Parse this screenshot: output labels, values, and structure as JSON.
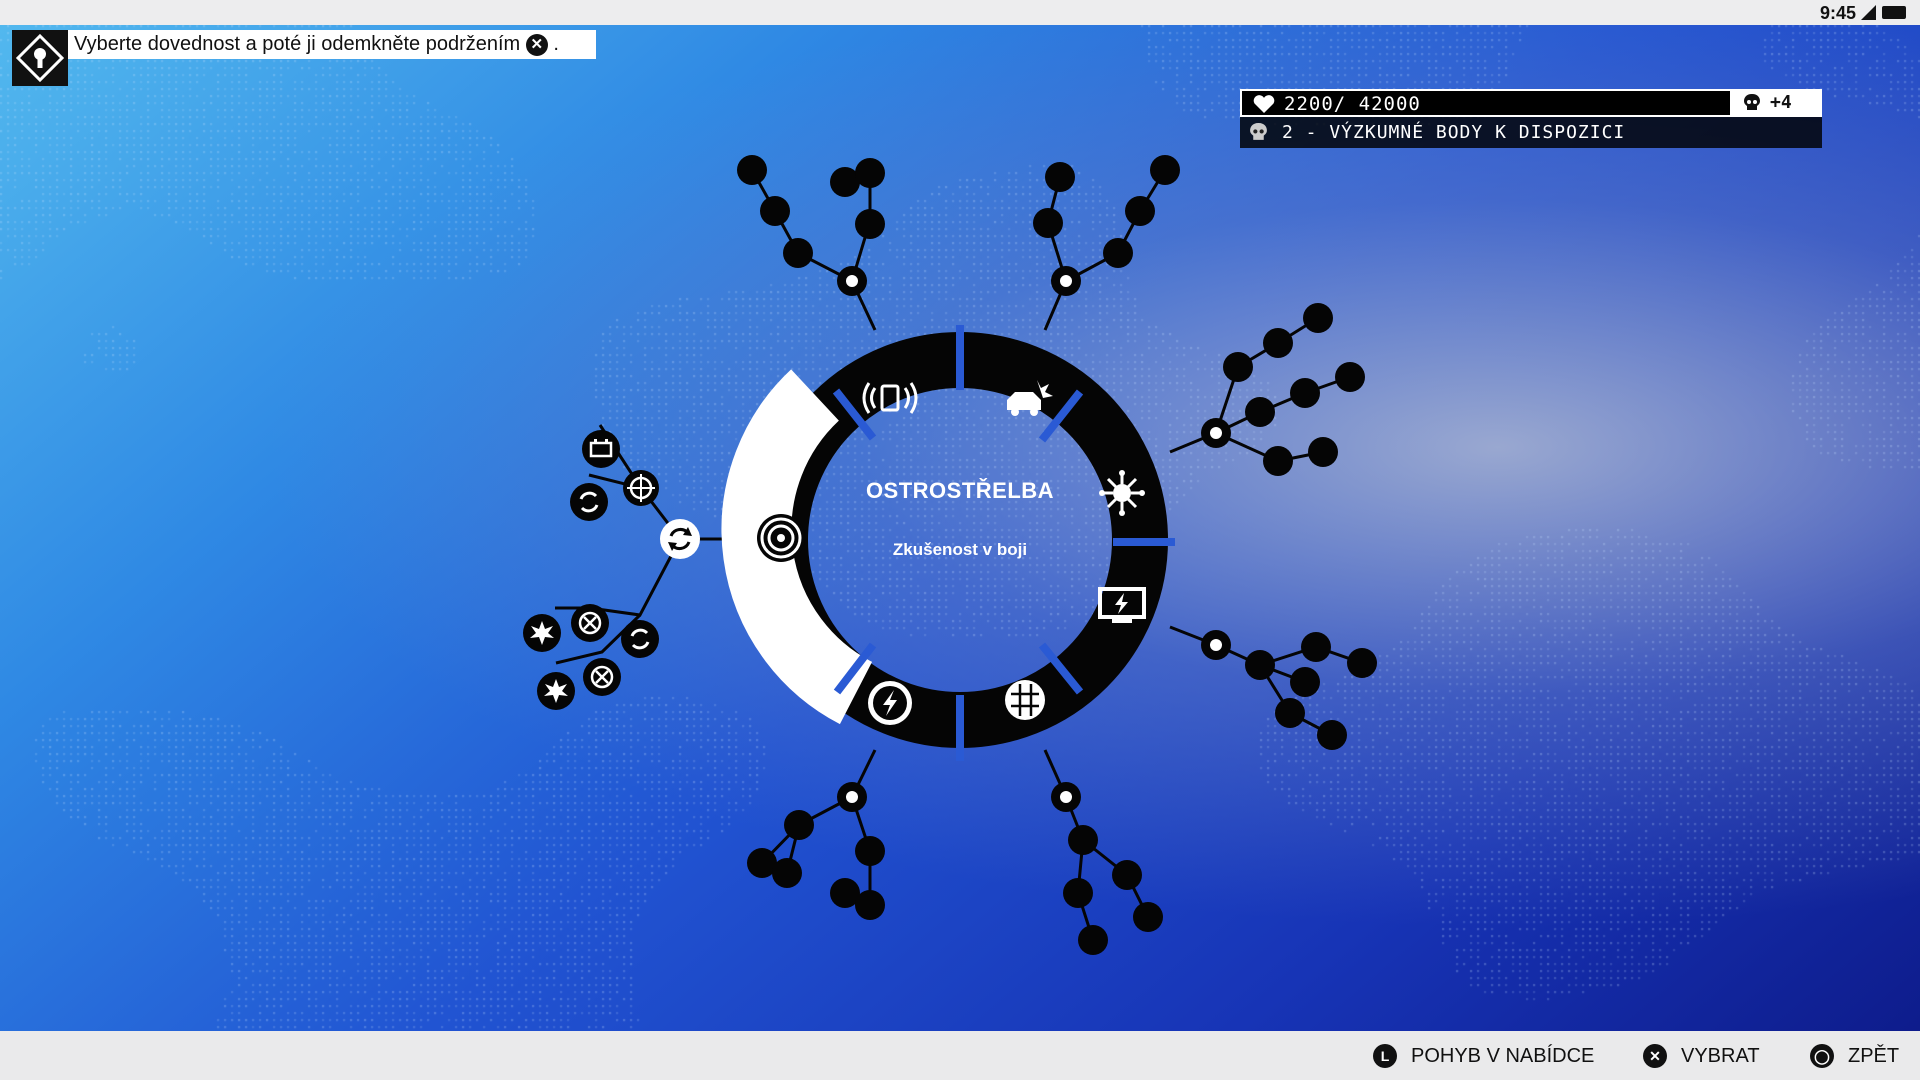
{
  "status_bar": {
    "time": "9:45"
  },
  "hint": {
    "text_before": "Vyberte dovednost a poté ji odemkněte podržením",
    "button_glyph": "✕",
    "text_after": "."
  },
  "resources": {
    "xp": "2200/ 42000",
    "skull_bonus": "+4",
    "research_points": "2 - VÝZKUMNÉ BODY K DISPOZICI"
  },
  "skill_wheel": {
    "selected_title": "OSTROSTŘELBA",
    "selected_subtitle": "Zkušenost v boji",
    "segments": [
      {
        "icon": "signal-hack-icon"
      },
      {
        "icon": "car-crash-icon"
      },
      {
        "icon": "virus-icon"
      },
      {
        "icon": "monitor-icon"
      },
      {
        "icon": "circuit-shield-icon"
      },
      {
        "icon": "lightning-icon"
      },
      {
        "icon": "target-icon",
        "selected": true
      }
    ],
    "branch_icons": [
      "reload-icon",
      "crosshair-icon",
      "reload-icon",
      "battery-icon",
      "explosion-icon",
      "grid-target-icon",
      "reload-icon",
      "explosion-icon",
      "grid-target-icon"
    ]
  },
  "prompts": {
    "move": {
      "button": "L",
      "label": "POHYB V NABÍDCE"
    },
    "select": {
      "button": "✕",
      "label": "VYBRAT"
    },
    "back": {
      "button": "◯",
      "label": "ZPĚT"
    }
  },
  "colors": {
    "accent_white": "#ffffff",
    "wheel_black": "#050505",
    "bg_blue": "#2154d2"
  }
}
